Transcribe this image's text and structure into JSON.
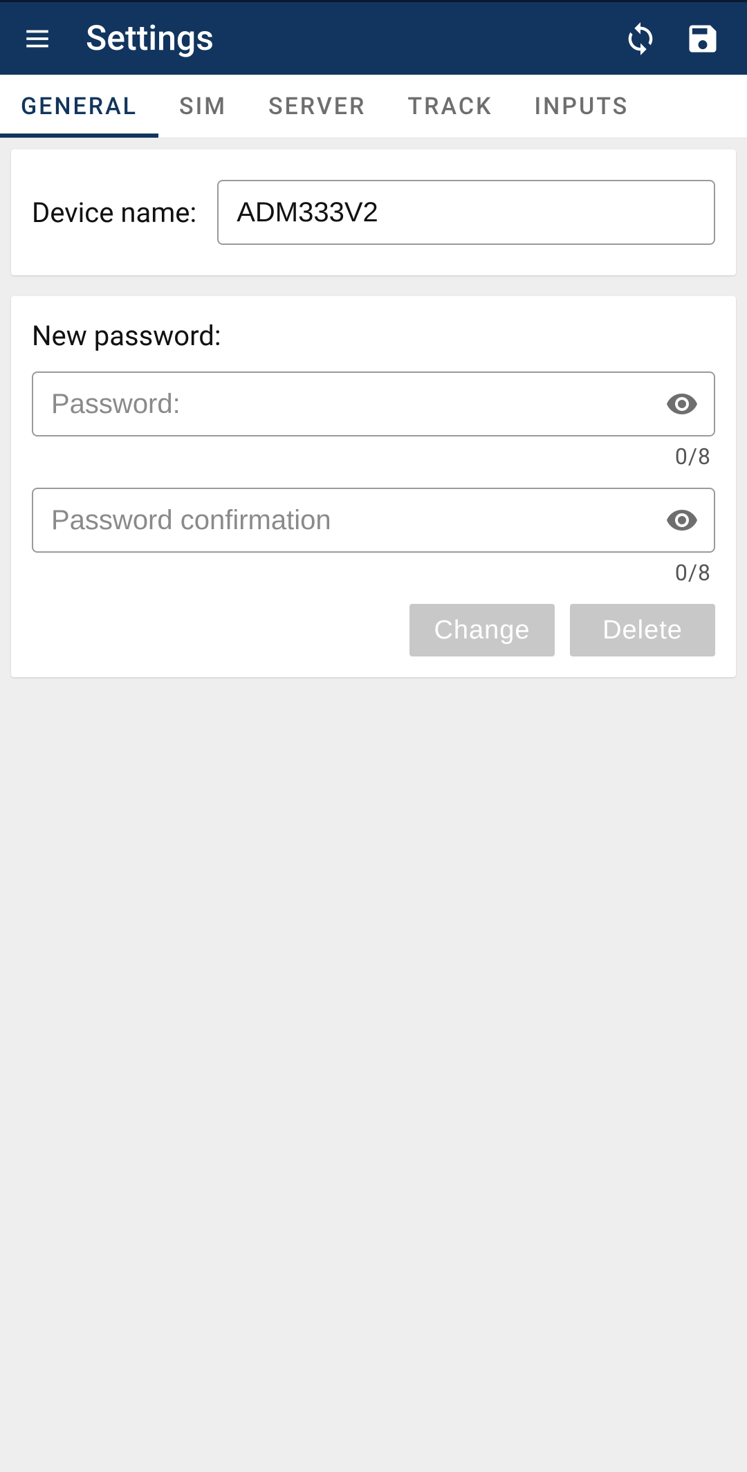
{
  "header": {
    "title": "Settings"
  },
  "tabs": [
    {
      "label": "GENERAL",
      "active": true
    },
    {
      "label": "SIM"
    },
    {
      "label": "SERVER"
    },
    {
      "label": "TRACK"
    },
    {
      "label": "INPUTS"
    }
  ],
  "device": {
    "label": "Device name:",
    "value": "ADM333V2"
  },
  "password": {
    "section_title": "New password:",
    "field1_placeholder": "Password:",
    "field1_value": "",
    "field1_counter": "0/8",
    "field2_placeholder": "Password confirmation",
    "field2_value": "",
    "field2_counter": "0/8",
    "change_label": "Change",
    "delete_label": "Delete"
  }
}
